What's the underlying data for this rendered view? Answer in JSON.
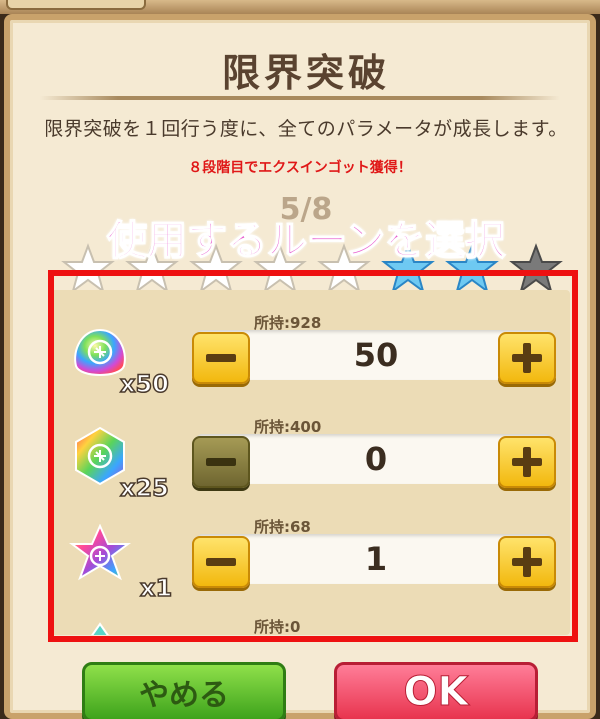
{
  "dialog": {
    "title": "限界突破",
    "description": "限界突破を１回行う度に、全てのパラメータが成長します。",
    "bonus_note": "８段階目でエクスインゴット獲得！",
    "stage_progress": "5/8",
    "overlay_caption": "使用するルーンを選択"
  },
  "stars": {
    "total": 8,
    "filled_white": 5,
    "filled_blue": 2,
    "empty": 1,
    "colors": {
      "white": "#ffffff",
      "blue": "#6ec9f2",
      "empty": "#7a7a7a"
    }
  },
  "runes": [
    {
      "icon": "rainbow-slime-rune-icon",
      "multiplier": "x50",
      "owned": "所持:928",
      "quantity": "50",
      "minus_enabled": true
    },
    {
      "icon": "rainbow-hexagon-rune-icon",
      "multiplier": "x25",
      "owned": "所持:400",
      "quantity": "0",
      "minus_enabled": false
    },
    {
      "icon": "rainbow-star-rune-icon",
      "multiplier": "x1",
      "owned": "所持:68",
      "quantity": "1",
      "minus_enabled": true
    },
    {
      "icon": "rainbow-rune-icon",
      "owned": "所持:0"
    }
  ],
  "buttons": {
    "cancel_label": "やめる",
    "ok_label": "OK"
  },
  "colors": {
    "highlight_frame": "#ee1111",
    "caption": "#e85ed0",
    "bonus_text": "#e01818"
  }
}
